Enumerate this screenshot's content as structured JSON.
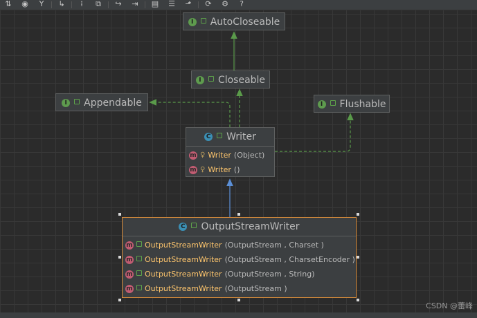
{
  "toolbar": {
    "buttons": [
      {
        "name": "fields-icon",
        "glyph": "⇅"
      },
      {
        "name": "eye-icon",
        "glyph": "◉"
      },
      {
        "name": "filter-icon",
        "glyph": "Y"
      },
      {
        "name": "edge-icon",
        "glyph": "↳"
      },
      {
        "name": "layout-icon",
        "glyph": "⁞"
      },
      {
        "name": "fit-icon",
        "glyph": "⧉"
      },
      {
        "name": "share-icon",
        "glyph": "↪"
      },
      {
        "name": "arrow-icon",
        "glyph": "⇥"
      },
      {
        "name": "notes-icon",
        "glyph": "▤"
      },
      {
        "name": "align-icon",
        "glyph": "☰"
      },
      {
        "name": "chart-icon",
        "glyph": "⬏"
      },
      {
        "name": "refresh-icon",
        "glyph": "⟳"
      },
      {
        "name": "gear-icon",
        "glyph": "⚙"
      },
      {
        "name": "help-icon",
        "glyph": "?"
      }
    ]
  },
  "nodes": {
    "autocloseable": {
      "kind": "I",
      "name": "AutoCloseable"
    },
    "closeable": {
      "kind": "I",
      "name": "Closeable"
    },
    "appendable": {
      "kind": "I",
      "name": "Appendable"
    },
    "flushable": {
      "kind": "I",
      "name": "Flushable"
    },
    "writer": {
      "kind": "C",
      "name": "Writer",
      "members": [
        {
          "badge": "m",
          "name": "Writer",
          "params": "(Object)"
        },
        {
          "badge": "m",
          "name": "Writer",
          "params": "()"
        }
      ]
    },
    "outputstreamwriter": {
      "kind": "C",
      "name": "OutputStreamWriter",
      "members": [
        {
          "badge": "m",
          "name": "OutputStreamWriter",
          "params": "(OutputStream , Charset )"
        },
        {
          "badge": "m",
          "name": "OutputStreamWriter",
          "params": "(OutputStream , CharsetEncoder )"
        },
        {
          "badge": "m",
          "name": "OutputStreamWriter",
          "params": "(OutputStream , String)"
        },
        {
          "badge": "m",
          "name": "OutputStreamWriter",
          "params": "(OutputStream )"
        }
      ]
    }
  },
  "colors": {
    "interface_edge": "#5a9a4a",
    "extends_edge": "#5b8fd6",
    "selection_border": "#d98d3a"
  },
  "watermark": "CSDN @蕾峰"
}
